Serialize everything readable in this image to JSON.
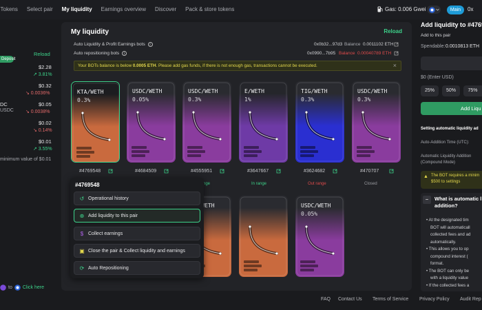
{
  "nav": {
    "items": [
      {
        "label": "0 Tokens"
      },
      {
        "label": "Select pair"
      },
      {
        "label": "My liquidity"
      },
      {
        "label": "Earnings overview"
      },
      {
        "label": "Discover"
      },
      {
        "label": "Pack & store tokens"
      }
    ],
    "gas": "Gas: 0.006 Gwei",
    "network_label": "Main",
    "address_frag": "0x"
  },
  "left": {
    "deposit_label": "Deposit",
    "reload_label": "Reload",
    "rows": [
      {
        "name": "",
        "value": "$2.28",
        "change": "↗ 3.81%",
        "up": true
      },
      {
        "name": "",
        "value": "$0.32",
        "change": "↘ 0.0036%",
        "up": false
      },
      {
        "name": "DC",
        "sub": "USDC",
        "value": "$0.05",
        "change": "↘ 0.0038%",
        "up": false
      },
      {
        "name": "",
        "value": "$0.02",
        "change": "↘ 0.14%",
        "up": false
      },
      {
        "name": "",
        "value": "$0.01",
        "change": "↗ 3.55%",
        "up": true
      }
    ],
    "min_note": "minimum value of $0.01",
    "bottom_to": "to",
    "bottom_link": "Click here"
  },
  "main": {
    "title": "My liquidity",
    "reload": "Reload",
    "row1_label": "Auto Liquidity & Profit Earnings bots",
    "row1_addr": "0x0b32...97d3",
    "row1_balance_label": "Balance",
    "row1_balance": "0.0011102 ETH",
    "row2_label": "Auto repositioning bots",
    "row2_addr": "0x0990...7b95",
    "row2_balance_label": "Balance",
    "row2_balance": "0.00040789 ETH",
    "warning_prefix": "Your BOTs balance is below ",
    "warning_amount": "0.0005 ETH",
    "warning_suffix": ". Please add gas funds, if there is not enough gas, transactions cannot be executed.",
    "cards_row1": [
      {
        "pair": "KTA/WETH",
        "fee": "0.3%",
        "id": "#4769548",
        "status": "",
        "status_color": "#3dd28a",
        "top": "#1c1d20",
        "bottom": "#c96a3e"
      },
      {
        "pair": "USDC/WETH",
        "fee": "0.05%",
        "id": "#4684509",
        "status": "",
        "status_color": "#3dd28a",
        "top": "#2a2b30",
        "bottom": "#8a3c9e"
      },
      {
        "pair": "USDC/WETH",
        "fee": "0.3%",
        "id": "#4555951",
        "status": "In range",
        "status_color": "#3dd28a",
        "top": "#2a2b30",
        "bottom": "#8a3c9e"
      },
      {
        "pair": "E/WETH",
        "fee": "1%",
        "id": "#3647667",
        "status": "In range",
        "status_color": "#3dd28a",
        "top": "#25262b",
        "bottom": "#6e3aa6"
      },
      {
        "pair": "TIG/WETH",
        "fee": "0.3%",
        "id": "#3624682",
        "status": "Out range",
        "status_color": "#e04b4b",
        "top": "#2a2b30",
        "bottom": "#2a2fd1"
      },
      {
        "pair": "USDC/WETH",
        "fee": "0.3%",
        "id": "#470707",
        "status": "Closed",
        "status_color": "#9a9ba0",
        "top": "#2a2b30",
        "bottom": "#8a3c9e"
      }
    ],
    "cards_row2": [
      {
        "pair": "KTA/WETH",
        "fee": "0.3%",
        "top": "#2a2b30",
        "bottom": "#c96a3e"
      },
      {
        "pair": "",
        "fee": "",
        "top": "#2a2b30",
        "bottom": "#c96a3e"
      },
      {
        "pair": "USDC/WETH",
        "fee": "0.05%",
        "top": "#2a2b30",
        "bottom": "#8a3c9e"
      }
    ]
  },
  "popup": {
    "title": "#4769548",
    "items": [
      {
        "label": "Operational history",
        "icon": "history-icon"
      },
      {
        "label": "Add liquidity to this pair",
        "icon": "add-liquidity-icon"
      },
      {
        "label": "Collect earnings",
        "icon": "collect-icon"
      },
      {
        "label": "Close the pair & Collect liquidity and earnings",
        "icon": "close-pair-icon"
      },
      {
        "label": "Auto Repositioning",
        "icon": "reposition-icon"
      }
    ]
  },
  "right": {
    "title": "Add liquidity to #4769",
    "subtitle": "Add to this pair",
    "spendable_label": "Spendable:",
    "spendable_value": "0.0010813 ETH",
    "usd_placeholder": "$0 (Enter USD)",
    "percents": [
      "25%",
      "50%",
      "75%"
    ],
    "add_button": "Add Liqu",
    "setting_title": "Setting automatic liquidity ad",
    "auto_time_label": "Auto-Addition Time (UTC):",
    "auto_mode_label_1": "Automatic Liquidity Addition",
    "auto_mode_label_2": "(Compound Mode)",
    "notice_1": "The BOT requires a minim",
    "notice_2": "$500 to settings",
    "faq_q1": "What is automatic l",
    "faq_q2": "addition?",
    "bullets": [
      "At the designated tim",
      "BOT will automaticall",
      "collected fees and ad",
      "automatically.",
      "This allows you to op",
      "compound interest (",
      "format.",
      "The BOT can only be",
      "with a liquidity value",
      "If the collected fees a"
    ]
  },
  "footer": {
    "faq": "FAQ",
    "contact": "Contact Us",
    "terms": "Terms of Service",
    "privacy": "Privacy Policy",
    "audit": "Audit Rep"
  }
}
